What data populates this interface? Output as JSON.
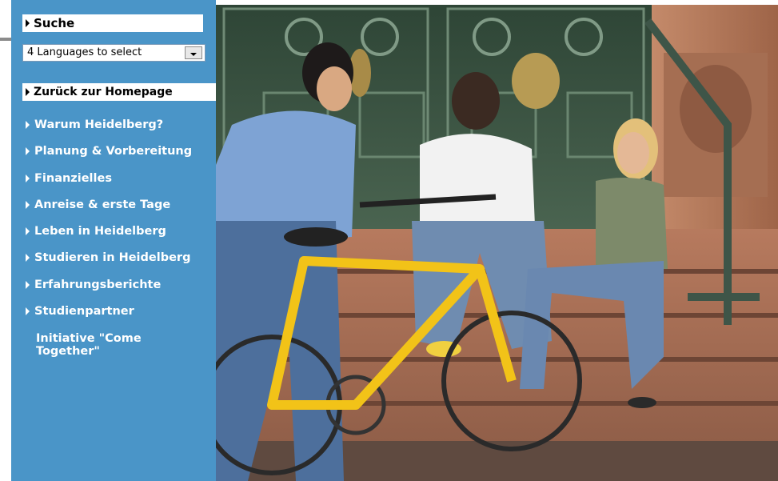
{
  "sidebar": {
    "search_label": "Suche",
    "language_select_value": "4 Languages to select",
    "home_link": "Zurück zur Homepage",
    "items": [
      {
        "label": "Warum Heidelberg?"
      },
      {
        "label": "Planung & Vorbereitung"
      },
      {
        "label": "Finanzielles"
      },
      {
        "label": "Anreise & erste Tage"
      },
      {
        "label": "Leben in Heidelberg"
      },
      {
        "label": "Studieren in Heidelberg"
      },
      {
        "label": "Erfahrungsberichte"
      },
      {
        "label": "Studienpartner"
      }
    ],
    "initiative_link": "Initiative \"Come Together\""
  },
  "colors": {
    "sidebar_bg": "#4a95c8",
    "bike_yellow": "#f2c318",
    "door_green": "#3e5a45",
    "stone": "#b87a5c"
  },
  "icons": [
    "arrow-right-icon",
    "dropdown-arrow-icon"
  ]
}
